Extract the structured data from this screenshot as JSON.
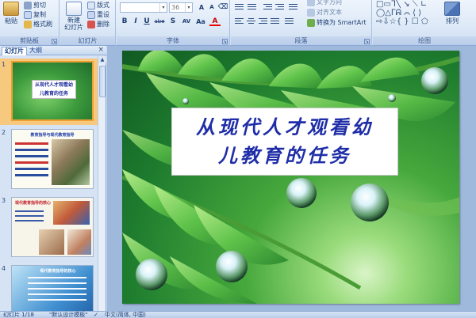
{
  "ribbon": {
    "clipboard": {
      "paste": "粘贴",
      "cut": "剪切",
      "copy": "复制",
      "format_painter": "格式刷",
      "label": "剪贴板"
    },
    "slides": {
      "new_slide": "新建\n幻灯片",
      "layout": "版式",
      "reset": "重设",
      "delete": "删除",
      "label": "幻灯片"
    },
    "font": {
      "font_name": "",
      "font_size": "36",
      "bold": "B",
      "italic": "I",
      "underline": "U",
      "strike": "abe",
      "shadow": "S",
      "spacing": "AV",
      "case": "Aa",
      "color": "A",
      "label": "字体"
    },
    "paragraph": {
      "text_direction": "文字方向",
      "align_text": "对齐文本",
      "smartart": "转换为 SmartArt",
      "label": "段落"
    },
    "drawing": {
      "arrange": "排列",
      "label": "绘图"
    }
  },
  "panel": {
    "tabs": [
      "幻灯片",
      "大纲"
    ],
    "close": "×",
    "thumbnails": [
      {
        "num": "1",
        "title_lines": [
          "从现代人才观看幼",
          "儿教育的任务"
        ]
      },
      {
        "num": "2",
        "title": "教育指导与现代教育指导"
      },
      {
        "num": "3",
        "title": "现代教育指导的核心"
      },
      {
        "num": "4",
        "title": "现代教育指导的核心"
      }
    ]
  },
  "slide": {
    "title_line1": "从现代人才观看幼",
    "title_line2": "儿教育的任务"
  },
  "status": {
    "slide_counter": "幻灯片 1/18",
    "theme": "\"默认设计模板\"",
    "language": "中文(简体, 中国)"
  },
  "colors": {
    "accent": "#15428b",
    "title_text": "#1f2ea8",
    "selection": "#f0a030"
  },
  "icons": [
    "paste-icon",
    "cut-icon",
    "copy-icon",
    "format-painter-icon",
    "new-slide-icon",
    "arrange-icon",
    "close-icon",
    "dialog-launcher-icon",
    "check-icon"
  ]
}
